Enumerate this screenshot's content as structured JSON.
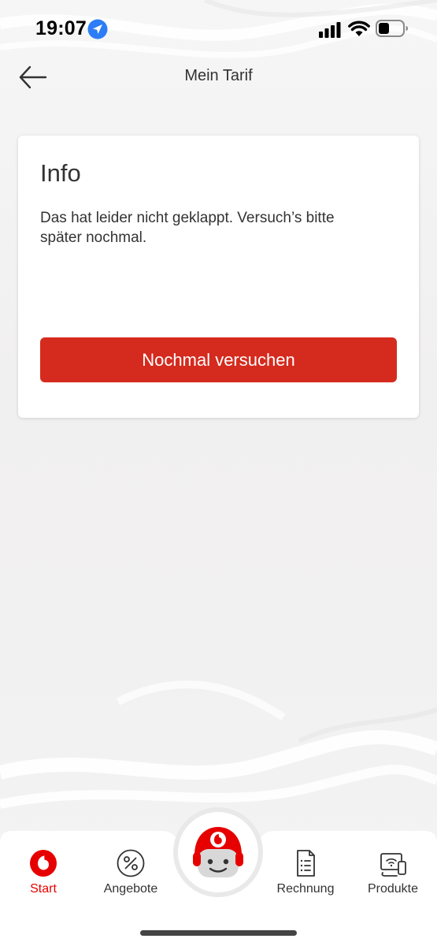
{
  "status_bar": {
    "time": "19:07",
    "icons": [
      "location-arrow-icon",
      "cellular-signal-icon",
      "wifi-icon",
      "battery-icon"
    ]
  },
  "header": {
    "title": "Mein Tarif",
    "back_icon": "arrow-left-icon"
  },
  "info_card": {
    "title": "Info",
    "message": "Das hat leider nicht geklappt. Versuch’s bitte später nochmal.",
    "button_label": "Nochmal versuchen"
  },
  "bottom_nav": {
    "items": [
      {
        "label": "Start",
        "icon": "vodafone-logo-icon",
        "active": true
      },
      {
        "label": "Angebote",
        "icon": "percent-icon",
        "active": false
      },
      {
        "label": "Rechnung",
        "icon": "document-list-icon",
        "active": false
      },
      {
        "label": "Produkte",
        "icon": "devices-icon",
        "active": false
      }
    ],
    "center_icon": "tobi-chatbot-icon"
  },
  "colors": {
    "accent": "#e60000",
    "button": "#d52b1e",
    "text": "#333333",
    "background": "#f2f1f1"
  }
}
